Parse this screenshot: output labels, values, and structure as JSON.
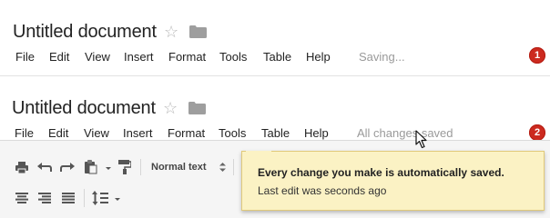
{
  "screen_1": {
    "doc_title": "Untitled document",
    "menu": [
      "File",
      "Edit",
      "View",
      "Insert",
      "Format",
      "Tools",
      "Table",
      "Help"
    ],
    "status": "Saving...",
    "step": "1"
  },
  "screen_2": {
    "doc_title": "Untitled document",
    "menu": [
      "File",
      "Edit",
      "View",
      "Insert",
      "Format",
      "Tools",
      "Table",
      "Help"
    ],
    "status": "All changes saved",
    "step": "2",
    "toolbar": {
      "style_select": "Normal text"
    },
    "tooltip": {
      "title": "Every change you make is automatically saved.",
      "subtitle": "Last edit was seconds ago"
    }
  },
  "icons": [
    "star-icon",
    "folder-icon",
    "print-icon",
    "undo-icon",
    "redo-icon",
    "paste-icon",
    "paint-format-icon",
    "align-left-icon",
    "align-center-icon",
    "justify-icon",
    "line-spacing-icon",
    "cursor-icon"
  ],
  "colors": {
    "badge": "#cc2a1f",
    "tooltip_bg": "#fbf2c4",
    "status_text": "#9a9a9a"
  }
}
